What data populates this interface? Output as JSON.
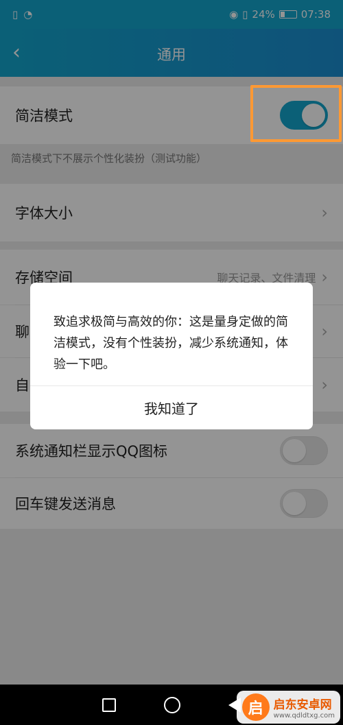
{
  "status_bar": {
    "left_icons": [
      "sim-card-icon",
      "wifi-icon"
    ],
    "right_icons": [
      "eye-icon",
      "vibrate-icon"
    ],
    "battery_percent": "24%",
    "time": "07:38",
    "battery_level": 0.24
  },
  "header": {
    "title": "通用",
    "back_icon": "‹"
  },
  "rows": {
    "simple_mode": {
      "label": "简洁模式",
      "toggle_on": true
    },
    "simple_mode_hint": "简洁模式下不展示个性化装扮（测试功能）",
    "font_size": {
      "label": "字体大小"
    },
    "storage": {
      "label": "存储空间",
      "sub": "聊天记录、文件清理"
    },
    "chat_row_label": "聊",
    "auto_row_label": "自",
    "qq_icon_notify": {
      "label": "系统通知栏显示QQ图标",
      "toggle_on": false
    },
    "enter_send": {
      "label": "回车键发送消息",
      "toggle_on": false
    },
    "chevron": "›"
  },
  "dialog": {
    "message": "致追求极简与高效的你：这是量身定做的简洁模式，没有个性装扮，减少系统通知，体验一下吧。",
    "button": "我知道了"
  },
  "watermark": {
    "logo_char": "启",
    "name": "启东安卓网",
    "url": "www.qdldtxg.com"
  },
  "colors": {
    "accent": "#13a6cd",
    "highlight": "#ff9933",
    "overlay": "rgba(0,0,0,0.42)"
  }
}
